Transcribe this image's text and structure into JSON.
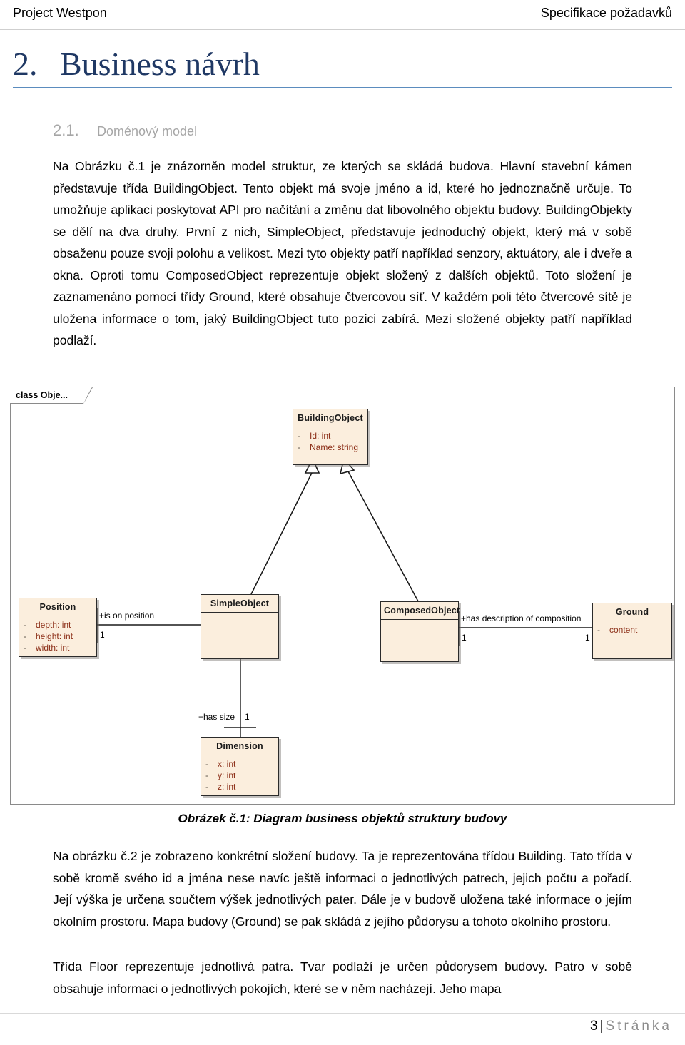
{
  "header": {
    "left": "Project Westpon",
    "right": "Specifikace požadavků"
  },
  "headings": {
    "h1_number": "2.",
    "h1_text": "Business návrh",
    "h2_number": "2.1.",
    "h2_text": "Doménový model"
  },
  "paragraphs": {
    "p1": "Na Obrázku č.1 je znázorněn model struktur, ze kterých se skládá budova. Hlavní stavební kámen představuje třída BuildingObject. Tento objekt má svoje jméno a id, které ho jednoznačně určuje. To umožňuje aplikaci poskytovat API pro načítání a změnu dat libovolného objektu budovy. BuildingObjekty se dělí na dva druhy. První z nich, SimpleObject, představuje jednoduchý objekt, který má v sobě obsaženu pouze svoji polohu a velikost. Mezi tyto objekty patří například senzory, aktuátory, ale i dveře a okna. Oproti tomu ComposedObject reprezentuje objekt složený z dalších objektů. Toto složení je zaznamenáno pomocí třídy Ground, které obsahuje čtvercovou síť. V každém poli této čtvercové sítě je uložena informace o tom, jaký BuildingObject tuto pozici zabírá. Mezi složené objekty patří například podlaží.",
    "p2": "Na obrázku č.2 je zobrazeno konkrétní složení budovy. Ta je reprezentována třídou Building. Tato třída v sobě kromě svého id a jména nese navíc ještě informaci o jednotlivých patrech, jejich počtu a pořadí. Její výška je určena součtem výšek jednotlivých pater. Dále je v budově uložena také informace o jejím okolním prostoru. Mapa budovy (Ground) se pak skládá z jejího půdorysu a tohoto okolního prostoru.",
    "p3": "Třída Floor reprezentuje jednotlivá patra. Tvar podlaží je určen půdorysem budovy. Patro v sobě obsahuje informaci o jednotlivých pokojích, které se v něm nacházejí. Jeho mapa"
  },
  "figure": {
    "caption": "Obrázek č.1: Diagram business objektů struktury budovy",
    "frame_tab_label": "class Obje...",
    "colors": {
      "class_fill": "#fbeedd",
      "class_border": "#2b2b2b",
      "attribute_text": "#8c2f18",
      "frame_border": "#8a8a8a"
    },
    "classes": [
      {
        "id": "buildingobject",
        "name": "BuildingObject",
        "attributes": [
          {
            "visibility": "-",
            "text": "Id: int"
          },
          {
            "visibility": "-",
            "text": "Name: string"
          }
        ]
      },
      {
        "id": "position",
        "name": "Position",
        "attributes": [
          {
            "visibility": "-",
            "text": "depth: int"
          },
          {
            "visibility": "-",
            "text": "height: int"
          },
          {
            "visibility": "-",
            "text": "width: int"
          }
        ]
      },
      {
        "id": "simpleobject",
        "name": "SimpleObject",
        "attributes": []
      },
      {
        "id": "composedobject",
        "name": "ComposedObject",
        "attributes": []
      },
      {
        "id": "ground",
        "name": "Ground",
        "attributes": [
          {
            "visibility": "-",
            "text": "content"
          }
        ]
      },
      {
        "id": "dimension",
        "name": "Dimension",
        "attributes": [
          {
            "visibility": "-",
            "text": "x: int"
          },
          {
            "visibility": "-",
            "text": "y: int"
          },
          {
            "visibility": "-",
            "text": "z: int"
          }
        ]
      }
    ],
    "relationships": [
      {
        "id": "pos-simple",
        "label": "+is on position",
        "source_mult": "1",
        "target_mult": ""
      },
      {
        "id": "composed-ground",
        "label": "+has description of composition",
        "source_mult": "1",
        "target_mult": "1"
      },
      {
        "id": "simple-dimension",
        "label": "+has size",
        "source_mult": "1",
        "target_mult": ""
      }
    ]
  },
  "footer": {
    "page_number": "3",
    "separator": "|",
    "page_word": "Stránka"
  }
}
